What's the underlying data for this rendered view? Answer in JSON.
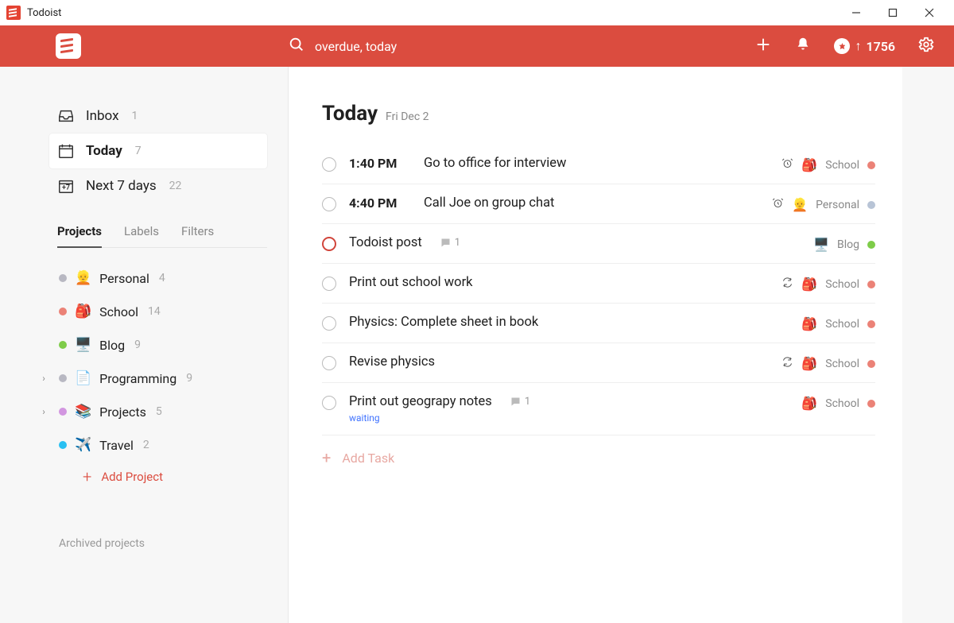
{
  "window": {
    "title": "Todoist"
  },
  "header": {
    "search_value": "overdue, today",
    "karma": "1756"
  },
  "sidebar": {
    "nav": {
      "inbox": {
        "label": "Inbox",
        "count": "1"
      },
      "today": {
        "label": "Today",
        "count": "7"
      },
      "next7": {
        "label": "Next 7 days",
        "count": "22"
      }
    },
    "tabs": {
      "projects": "Projects",
      "labels": "Labels",
      "filters": "Filters"
    },
    "projects": [
      {
        "emoji": "👱",
        "name": "Personal",
        "count": "4",
        "dot": "#b8b8c2",
        "expand": ""
      },
      {
        "emoji": "🎒",
        "name": "School",
        "count": "14",
        "dot": "#eb8277",
        "expand": ""
      },
      {
        "emoji": "🖥️",
        "name": "Blog",
        "count": "9",
        "dot": "#7ecc49",
        "expand": ""
      },
      {
        "emoji": "📄",
        "name": "Programming",
        "count": "9",
        "dot": "#b8b8c2",
        "expand": "›"
      },
      {
        "emoji": "📚",
        "name": "Projects",
        "count": "5",
        "dot": "#d296e0",
        "expand": "›"
      },
      {
        "emoji": "✈️",
        "name": "Travel",
        "count": "2",
        "dot": "#29c0f2",
        "expand": ""
      }
    ],
    "add_project": "Add Project",
    "archived": "Archived projects"
  },
  "main": {
    "title": "Today",
    "subtitle": "Fri Dec 2",
    "add_task": "Add Task",
    "tasks": [
      {
        "time": "1:40 PM",
        "title": "Go to office for interview",
        "project": "School",
        "proj_emoji": "🎒",
        "proj_dot": "#eb8277",
        "alarm": true,
        "recur": false,
        "priority": "",
        "comments": "",
        "sub": ""
      },
      {
        "time": "4:40 PM",
        "title": "Call Joe on group chat",
        "project": "Personal",
        "proj_emoji": "👱",
        "proj_dot": "#b8c4d6",
        "alarm": true,
        "recur": false,
        "priority": "",
        "comments": "",
        "sub": ""
      },
      {
        "time": "",
        "title": "Todoist post",
        "project": "Blog",
        "proj_emoji": "🖥️",
        "proj_dot": "#7ecc49",
        "alarm": false,
        "recur": false,
        "priority": "p1",
        "comments": "1",
        "sub": ""
      },
      {
        "time": "",
        "title": "Print out school work",
        "project": "School",
        "proj_emoji": "🎒",
        "proj_dot": "#eb8277",
        "alarm": false,
        "recur": true,
        "priority": "",
        "comments": "",
        "sub": ""
      },
      {
        "time": "",
        "title": "Physics: Complete sheet in book",
        "project": "School",
        "proj_emoji": "🎒",
        "proj_dot": "#eb8277",
        "alarm": false,
        "recur": false,
        "priority": "",
        "comments": "",
        "sub": ""
      },
      {
        "time": "",
        "title": "Revise physics",
        "project": "School",
        "proj_emoji": "🎒",
        "proj_dot": "#eb8277",
        "alarm": false,
        "recur": true,
        "priority": "",
        "comments": "",
        "sub": ""
      },
      {
        "time": "",
        "title": "Print out geograpy notes",
        "project": "School",
        "proj_emoji": "🎒",
        "proj_dot": "#eb8277",
        "alarm": false,
        "recur": false,
        "priority": "",
        "comments": "1",
        "sub": "waiting"
      }
    ]
  }
}
